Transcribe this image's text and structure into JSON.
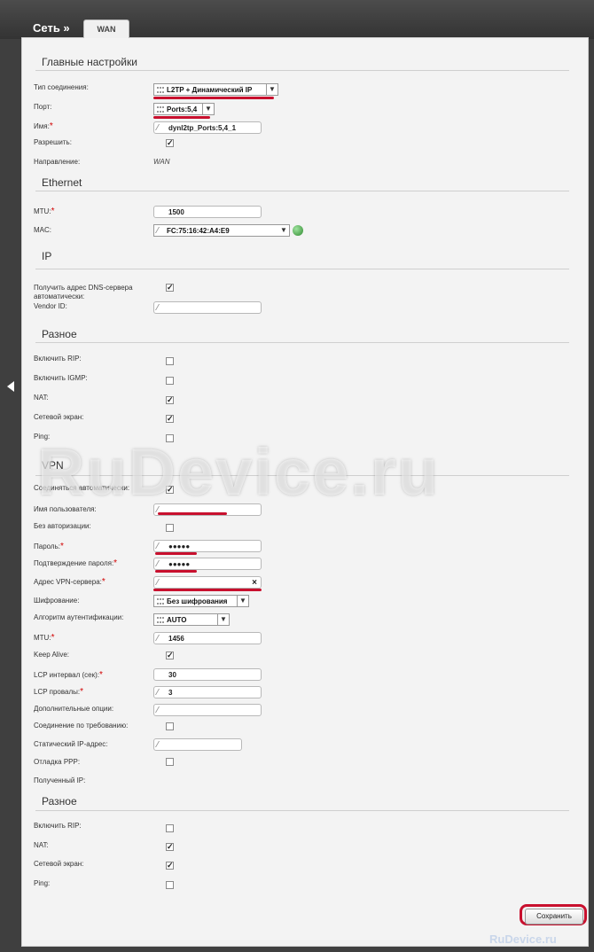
{
  "header": {
    "breadcrumb": "Сеть »",
    "tab": "WAN"
  },
  "sections": {
    "main": "Главные настройки",
    "ethernet": "Ethernet",
    "ip": "IP",
    "misc1": "Разное",
    "vpn": "VPN",
    "misc2": "Разное"
  },
  "main": {
    "conn_type_label": "Тип соединения:",
    "conn_type_value": "L2TP + Динамический IP",
    "port_label": "Порт:",
    "port_value": "Ports:5,4",
    "name_label": "Имя:",
    "name_value": "dynl2tp_Ports:5,4_1",
    "allow_label": "Разрешить:",
    "direction_label": "Направление:",
    "direction_value": "WAN"
  },
  "ethernet": {
    "mtu_label": "MTU:",
    "mtu_value": "1500",
    "mac_label": "MAC:",
    "mac_value": "FC:75:16:42:A4:E9"
  },
  "ip": {
    "dns_label_1": "Получить адрес DNS-сервера",
    "dns_label_2": "автоматически:",
    "vendor_label": "Vendor ID:"
  },
  "misc1": {
    "rip_label": "Включить RIP:",
    "igmp_label": "Включить IGMP:",
    "nat_label": "NAT:",
    "firewall_label": "Сетевой экран:",
    "ping_label": "Ping:"
  },
  "vpn": {
    "auto_label": "Соединяться автоматически:",
    "user_label": "Имя пользователя:",
    "noauth_label": "Без авторизации:",
    "pass_label": "Пароль:",
    "pass_value": "●●●●●",
    "pass2_label": "Подтверждение пароля:",
    "pass2_value": "●●●●●",
    "server_label": "Адрес VPN-сервера:",
    "server_clear": "×",
    "enc_label": "Шифрование:",
    "enc_value": "Без шифрования",
    "auth_label": "Алгоритм аутентификации:",
    "auth_value": "AUTO",
    "mtu_label": "MTU:",
    "mtu_value": "1456",
    "keepalive_label": "Keep Alive:",
    "lcp_int_label": "LCP интервал (сек):",
    "lcp_int_value": "30",
    "lcp_fail_label": "LCP провалы:",
    "lcp_fail_value": "3",
    "extra_label": "Дополнительные опции:",
    "ondemand_label": "Соединение по требованию:",
    "static_ip_label": "Статический IP-адрес:",
    "ppp_debug_label": "Отладка PPP:",
    "got_ip_label": "Полученный IP:"
  },
  "misc2": {
    "rip_label": "Включить RIP:",
    "nat_label": "NAT:",
    "firewall_label": "Сетевой экран:",
    "ping_label": "Ping:"
  },
  "checkmark": "✓",
  "required_mark": "*",
  "dropdown_arrow": "▼",
  "save_label": "Сохранить",
  "watermark": "RuDevice.ru",
  "watermark_small": "RuDevice.ru",
  "colors": {
    "accent_red": "#c8102e",
    "panel_bg": "#f3f3f3",
    "frame_bg": "#3f3f3f"
  }
}
